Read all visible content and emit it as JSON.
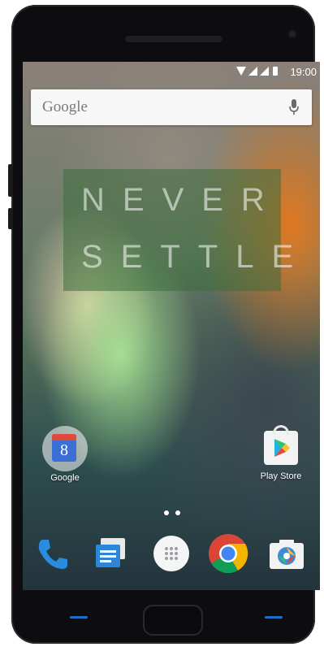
{
  "status_bar": {
    "time": "19:00",
    "icons": [
      "wifi-icon",
      "signal-icon",
      "signal-icon",
      "battery-icon"
    ]
  },
  "search": {
    "placeholder": "Google",
    "mic_icon": "mic-icon"
  },
  "wallpaper_text": {
    "line1": "NEVER",
    "line2": "SETTLE"
  },
  "apps": [
    {
      "label": "Google",
      "icon": "google-folder-icon"
    },
    {
      "label": "Play Store",
      "icon": "play-store-icon"
    }
  ],
  "page_indicator": {
    "pages": 2,
    "current": 2
  },
  "dock": [
    {
      "icon": "phone-icon"
    },
    {
      "icon": "messaging-icon"
    },
    {
      "icon": "app-drawer-icon"
    },
    {
      "icon": "chrome-icon"
    },
    {
      "icon": "camera-icon"
    }
  ],
  "colors": {
    "accent": "#1c6fc4",
    "phone_body": "#0d0d0f",
    "banner": "#3c6e3c"
  }
}
